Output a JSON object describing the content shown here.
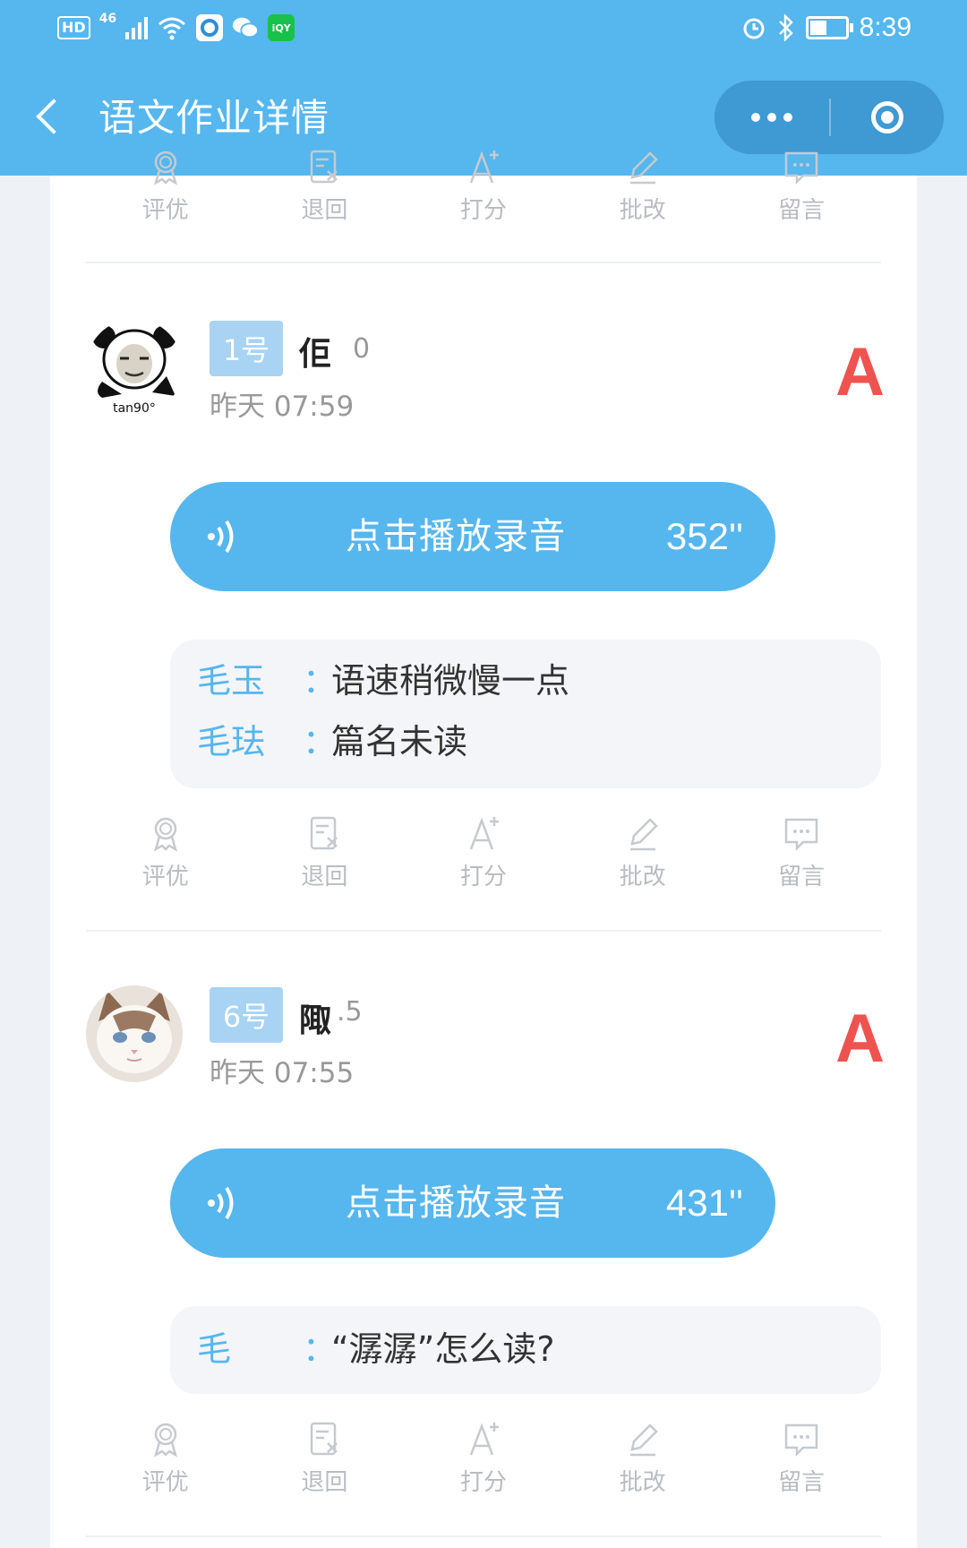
{
  "status_bar": {
    "hd": "HD",
    "network": "46",
    "time": "8:39"
  },
  "nav": {
    "title": "语文作业详情"
  },
  "actions": {
    "evaluate": "评优",
    "return": "退回",
    "score": "打分",
    "correct": "批改",
    "comment": "留言"
  },
  "entries": [
    {
      "number": "1号",
      "name": "佢",
      "score_fragment": "0",
      "time": "昨天 07:59",
      "grade": "A",
      "avatar_caption": "tan90°",
      "play_label": "点击播放录音",
      "duration": "352''",
      "comments": [
        {
          "author": "毛玉",
          "colon": "：",
          "text": "语速稍微慢一点"
        },
        {
          "author": "毛珐",
          "colon": "：",
          "text": "篇名未读"
        }
      ]
    },
    {
      "number": "6号",
      "name": "陬",
      "score_fragment": ".5",
      "time": "昨天 07:55",
      "grade": "A",
      "play_label": "点击播放录音",
      "duration": "431''",
      "comments": [
        {
          "author": "毛",
          "colon": "：",
          "text": "“潺潺”怎么读?"
        }
      ]
    }
  ],
  "colors": {
    "primary": "#56b6ee",
    "grade": "#ef5350",
    "badge": "#a8d3f2"
  }
}
